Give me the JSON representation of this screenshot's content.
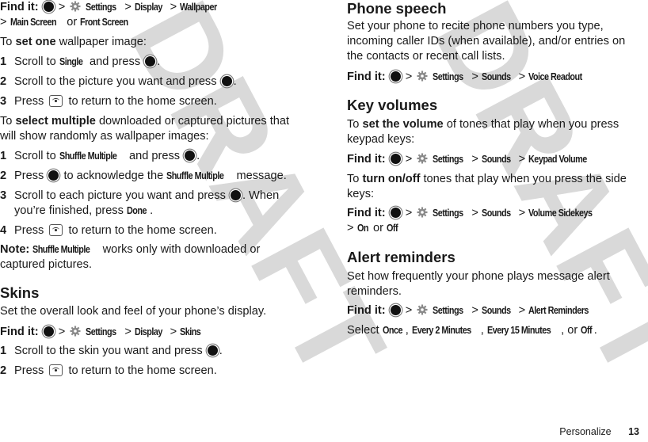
{
  "watermark": {
    "left": "DRAFT",
    "right": "DRAFT"
  },
  "icons": {
    "select_key": "select-key-icon",
    "settings": "gear-icon",
    "end_key": "end-key-icon"
  },
  "common": {
    "find_it": "Find it:",
    "sep": ">",
    "or": "or",
    "settings": "Settings",
    "press": "Press",
    "to_return": "to return to the home screen."
  },
  "left": {
    "find1": {
      "display": "Display",
      "wallpaper": "Wallpaper",
      "main_screen": "Main Screen",
      "front_screen": "Front Screen"
    },
    "set_one": {
      "to": "To",
      "bold": "set one",
      "rest": "wallpaper image:"
    },
    "steps_one": [
      {
        "num": "1",
        "pre": "Scroll to",
        "bold": "Single",
        "post": "and press"
      },
      {
        "num": "2",
        "pre": "Scroll to the picture you want and press"
      },
      {
        "num": "3"
      }
    ],
    "select_multiple": {
      "to": "To",
      "bold": "select multiple",
      "rest": "downloaded or captured pictures that will show randomly as wallpaper images:"
    },
    "steps_multi": [
      {
        "num": "1",
        "pre": "Scroll to",
        "bold": "Shuffle Multiple",
        "post": "and press"
      },
      {
        "num": "2",
        "pre": "Press",
        "mid": "to acknowledge the",
        "bold": "Shuffle Multiple",
        "post": "message."
      },
      {
        "num": "3",
        "pre": "Scroll to each picture you want and press",
        "mid": ". When you’re finished, press",
        "bold": "Done"
      },
      {
        "num": "4"
      }
    ],
    "note": {
      "label": "Note:",
      "bold": "Shuffle Multiple",
      "rest": "works only with downloaded or captured pictures."
    },
    "skins": {
      "title": "Skins",
      "desc": "Set the overall look and feel of your phone’s display.",
      "display": "Display",
      "skins": "Skins",
      "steps": [
        {
          "num": "1",
          "pre": "Scroll to the skin you want and press"
        },
        {
          "num": "2"
        }
      ]
    }
  },
  "right": {
    "phone_speech": {
      "title": "Phone speech",
      "desc": "Set your phone to recite phone numbers you type, incoming caller IDs (when available), and/or entries on the contacts or recent call lists.",
      "sounds": "Sounds",
      "dest": "Voice Readout"
    },
    "key_volumes": {
      "title": "Key volumes",
      "set_volume": {
        "to": "To",
        "bold": "set the volume",
        "rest": "of tones that play when you press keypad keys:"
      },
      "sounds": "Sounds",
      "dest1": "Keypad Volume",
      "turn_onoff": {
        "to": "To",
        "bold": "turn on/off",
        "rest": "tones that play when you press the side keys:"
      },
      "dest2": "Volume Sidekeys",
      "on": "On",
      "off": "Off"
    },
    "alert_reminders": {
      "title": "Alert reminders",
      "desc": "Set how frequently your phone plays message alert reminders.",
      "sounds": "Sounds",
      "dest": "Alert Reminders",
      "select": "Select",
      "options": [
        "Once",
        "Every 2 Minutes",
        "Every 15 Minutes",
        "Off"
      ],
      "or": "or"
    }
  },
  "footer": {
    "section": "Personalize",
    "page": "13"
  }
}
